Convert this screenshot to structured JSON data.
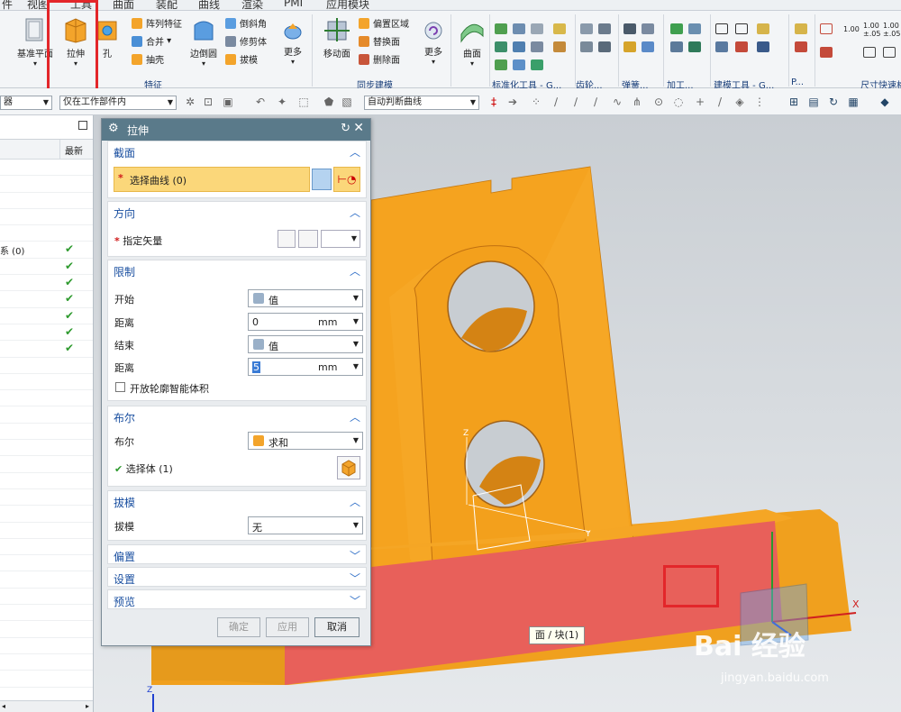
{
  "menu": [
    "件",
    "视图",
    "工具",
    "曲面",
    "装配",
    "曲线",
    "渲染",
    "PMI",
    "应用模块"
  ],
  "ribbon": {
    "big_buttons": {
      "datum_plane": "基准平面",
      "extrude": "拉伸",
      "hole": "孔",
      "edge_blend": "边倒圆",
      "more": "更多",
      "move_face": "移动面",
      "more2": "更多",
      "surface": "曲面"
    },
    "feature_items": [
      "阵列特征",
      "合并",
      "抽壳"
    ],
    "blend_items": [
      "倒斜角",
      "修剪体",
      "拔模"
    ],
    "sync_items": [
      "偏置区域",
      "替换面",
      "删除面"
    ],
    "mini_numbers": [
      "1.00",
      "1.00",
      "1.00"
    ],
    "mini_numbers_sub": [
      "±.05",
      "±.05"
    ],
    "groups": {
      "feature": "特征",
      "sync": "同步建模",
      "std_tools": "标准化工具 - G...",
      "gear": "齿轮...",
      "spring": "弹簧...",
      "machining": "加工...",
      "modeling_tools": "建模工具 - G...",
      "p": "P...",
      "dim_quick": "尺寸快速格"
    }
  },
  "toolbar2": {
    "filter": "器",
    "scope": "仅在工作部件内",
    "curve_rule": "自动判断曲线"
  },
  "navigator": {
    "col_latest": "最新",
    "rows": [
      "",
      "",
      "",
      "",
      "",
      "系 (0)",
      "",
      "",
      "",
      "",
      "",
      "",
      "",
      "",
      "",
      "",
      "",
      "",
      "",
      "",
      "",
      "",
      "",
      "",
      "",
      "",
      "",
      "",
      "",
      "",
      "",
      "",
      "",
      ""
    ],
    "checked_rows": [
      5,
      6,
      7,
      8,
      9,
      10,
      11
    ]
  },
  "dialog": {
    "title": "拉伸",
    "section": {
      "title": "截面",
      "select_curve": "选择曲线 (0)"
    },
    "direction": {
      "title": "方向",
      "specify_vector": "指定矢量"
    },
    "limits": {
      "title": "限制",
      "start_label": "开始",
      "start_value": "值",
      "distance1_label": "距离",
      "distance1_value": "0",
      "distance1_unit": "mm",
      "end_label": "结束",
      "end_value": "值",
      "distance2_label": "距离",
      "distance2_value": "5",
      "distance2_unit": "mm",
      "open_profile": "开放轮廓智能体积"
    },
    "boolean": {
      "title": "布尔",
      "label": "布尔",
      "value": "求和",
      "select_body": "选择体 (1)"
    },
    "draft": {
      "title": "拔模",
      "label": "拔模",
      "value": "无"
    },
    "offset_title": "偏置",
    "settings_title": "设置",
    "preview_title": "预览",
    "buttons": {
      "ok": "确定",
      "apply": "应用",
      "cancel": "取消"
    }
  },
  "viewport": {
    "tooltip": "面 / 块(1)",
    "axis_x": "X",
    "axis_y": "Y",
    "axis_z": "Z",
    "watermark": "Bai 经验",
    "watermark_url": "jingyan.baidu.com"
  },
  "colors": {
    "part_orange": "#f0a01e",
    "selected_face": "#e8605a",
    "highlight_red": "#e3262a",
    "dialog_title": "#5a7a8a",
    "section_blue": "#1a4fa0"
  }
}
